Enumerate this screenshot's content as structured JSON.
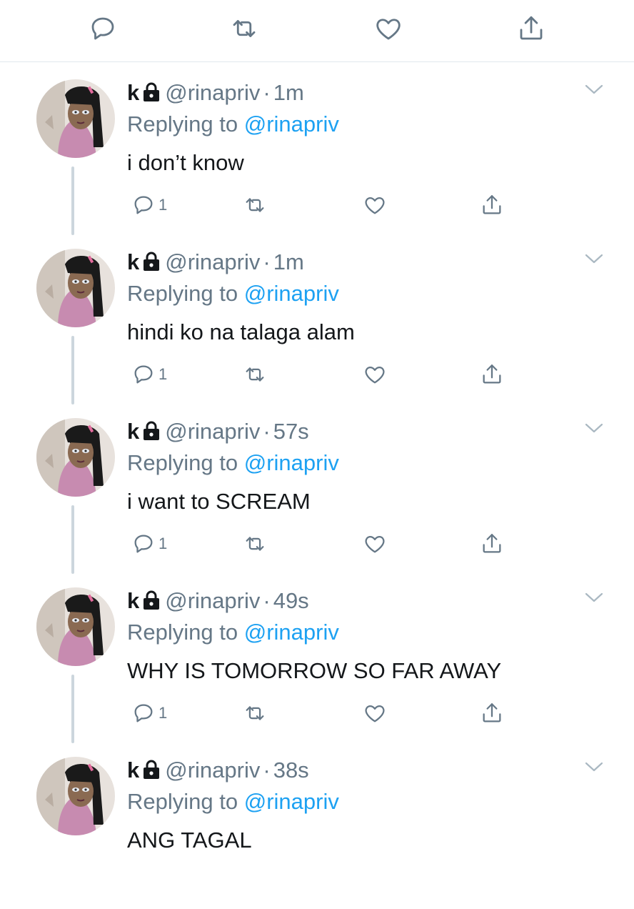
{
  "colors": {
    "link": "#1da1f2",
    "muted": "#657786",
    "text": "#14171a",
    "divider": "#e1e8ed",
    "thread": "#ccd6dd"
  },
  "top_actions": [
    "reply-icon",
    "retweet-icon",
    "like-icon",
    "share-icon"
  ],
  "tweets": [
    {
      "name": "k",
      "handle": "@rinapriv",
      "time": "1m",
      "replying_label": "Replying to",
      "replying_to": "@rinapriv",
      "text": "i don’t know",
      "reply_count": "1"
    },
    {
      "name": "k",
      "handle": "@rinapriv",
      "time": "1m",
      "replying_label": "Replying to",
      "replying_to": "@rinapriv",
      "text": "hindi ko na talaga alam",
      "reply_count": "1"
    },
    {
      "name": "k",
      "handle": "@rinapriv",
      "time": "57s",
      "replying_label": "Replying to",
      "replying_to": "@rinapriv",
      "text": "i want to SCREAM",
      "reply_count": "1"
    },
    {
      "name": "k",
      "handle": "@rinapriv",
      "time": "49s",
      "replying_label": "Replying to",
      "replying_to": "@rinapriv",
      "text": "WHY IS TOMORROW SO FAR AWAY",
      "reply_count": "1"
    },
    {
      "name": "k",
      "handle": "@rinapriv",
      "time": "38s",
      "replying_label": "Replying to",
      "replying_to": "@rinapriv",
      "text": "ANG TAGAL",
      "reply_count": ""
    }
  ]
}
